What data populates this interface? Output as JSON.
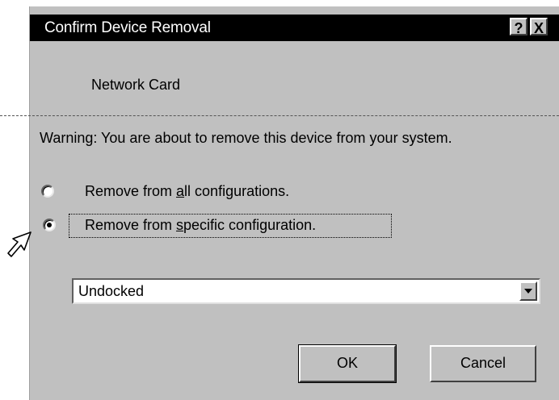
{
  "dialog": {
    "title": "Confirm Device Removal",
    "help_button": "?",
    "close_button": "X",
    "device_name": "Network Card",
    "warning": "Warning: You are about to remove this device from your system.",
    "options": [
      {
        "before": "Remove from ",
        "mnemonic": "a",
        "after": "ll configurations.",
        "selected": false
      },
      {
        "before": "Remove from ",
        "mnemonic": "s",
        "after": "pecific configuration.",
        "selected": true
      }
    ],
    "configuration_select": {
      "value": "Undocked"
    },
    "ok_label": "OK",
    "cancel_label": "Cancel"
  },
  "colors": {
    "title_bar": "#000000",
    "dialog_face": "#c0c0c0"
  },
  "icons": {
    "cursor": "arrow-cursor-icon",
    "dropdown": "chevron-down-icon"
  }
}
